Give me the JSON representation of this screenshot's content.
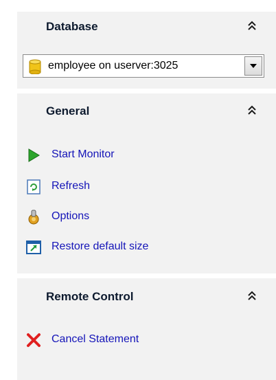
{
  "sections": {
    "database": {
      "title": "Database",
      "selected_connection": "employee on userver:3025"
    },
    "general": {
      "title": "General",
      "items": [
        {
          "label": "Start Monitor",
          "icon": "play-icon"
        },
        {
          "label": "Refresh",
          "icon": "refresh-icon"
        },
        {
          "label": "Options",
          "icon": "options-icon"
        },
        {
          "label": "Restore default size",
          "icon": "restore-size-icon"
        }
      ]
    },
    "remote_control": {
      "title": "Remote Control",
      "items": [
        {
          "label": "Cancel Statement",
          "icon": "cancel-x-icon"
        }
      ]
    }
  },
  "colors": {
    "panel_bg": "#f2f2f2",
    "link": "#1414b8",
    "title": "#0d1a2e"
  }
}
